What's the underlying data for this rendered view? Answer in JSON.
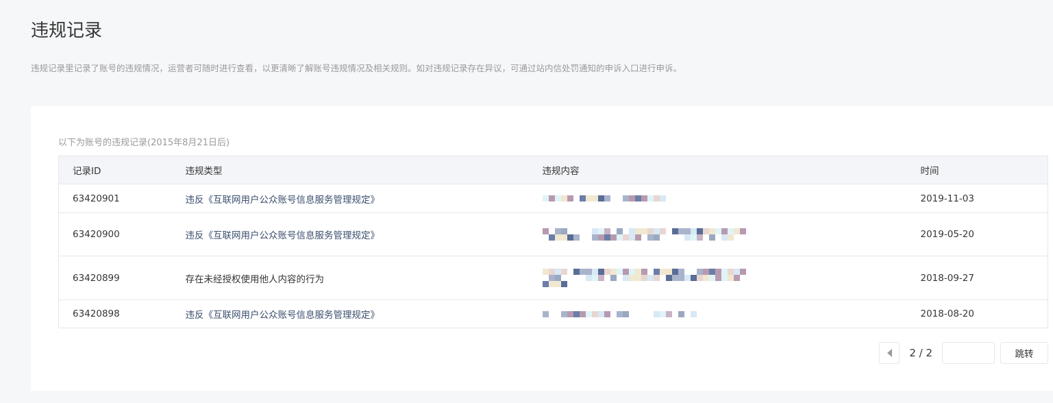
{
  "title": "违规记录",
  "description": "违规记录里记录了账号的违规情况，运营者可随时进行查看，以更清晰了解账号违规情况及相关规则。如对违规记录存在异议，可通过站内信处罚通知的申诉入口进行申诉。",
  "caption": "以下为账号的违规记录(2015年8月21日后)",
  "columns": [
    "记录ID",
    "违规类型",
    "违规内容",
    "时间"
  ],
  "rows": [
    {
      "id": "63420901",
      "type": "违反《互联网用户公众账号信息服务管理规定》",
      "time": "2019-11-03"
    },
    {
      "id": "63420900",
      "type": "违反《互联网用户公众账号信息服务管理规定》",
      "time": "2019-05-20"
    },
    {
      "id": "63420899",
      "type": "存在未经授权使用他人内容的行为",
      "time": "2018-09-27"
    },
    {
      "id": "63420898",
      "type": "违反《互联网用户公众账号信息服务管理规定》",
      "time": "2018-08-20"
    }
  ],
  "pagination": {
    "page": "2 / 2",
    "jump_label": "跳转",
    "input_value": ""
  }
}
